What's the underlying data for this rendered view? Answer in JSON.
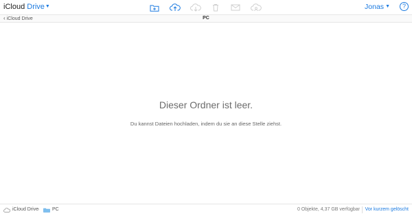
{
  "header": {
    "brand_prefix": "iCloud",
    "brand_app": "Drive",
    "user_name": "Jonas",
    "help_label": "?"
  },
  "toolbar": {
    "buttons": [
      {
        "icon": "new-folder-icon",
        "enabled": true
      },
      {
        "icon": "upload-icon",
        "enabled": true
      },
      {
        "icon": "download-icon",
        "enabled": false
      },
      {
        "icon": "trash-icon",
        "enabled": false
      },
      {
        "icon": "mail-icon",
        "enabled": false
      },
      {
        "icon": "share-icon",
        "enabled": false
      }
    ]
  },
  "nav": {
    "back_label": "iCloud Drive",
    "folder_title": "PC"
  },
  "main": {
    "empty_title": "Dieser Ordner ist leer.",
    "empty_subtitle": "Du kannst Dateien hochladen, indem du sie an diese Stelle ziehst."
  },
  "footer": {
    "path": [
      "iCloud Drive",
      "PC"
    ],
    "status": "0 Objekte, 4,37 GB verfügbar",
    "recently_deleted": "Vor kurzem gelöscht"
  },
  "colors": {
    "accent": "#1b7ae0",
    "disabled_icon": "#cfcfcf"
  }
}
